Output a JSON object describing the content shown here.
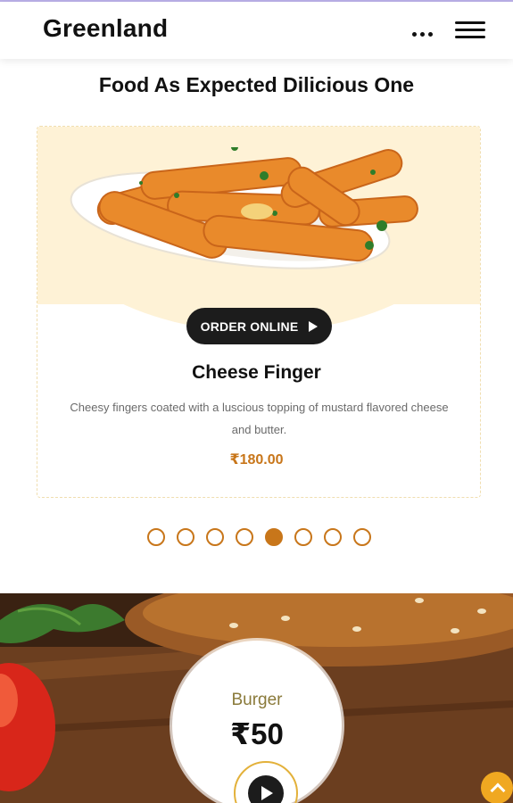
{
  "header": {
    "brand": "Greenland"
  },
  "section": {
    "title": "Food As Expected Dilicious One"
  },
  "slider": {
    "active_index": 4,
    "slide_count": 8,
    "card": {
      "order_label": "ORDER ONLINE",
      "name": "Cheese Finger",
      "description": "Cheesy fingers coated with a luscious topping of mustard flavored cheese and butter.",
      "price": "₹180.00"
    }
  },
  "promo": {
    "name": "Burger",
    "price": "₹50"
  },
  "icons": {
    "more": "more-dots-icon",
    "menu": "hamburger-menu-icon",
    "play": "play-icon",
    "scroll_top": "chevron-up-icon"
  },
  "colors": {
    "accent": "#c8761a",
    "card_bg": "#fef2d6",
    "dark": "#1c1c1c",
    "scroll_top": "#f0a821"
  }
}
